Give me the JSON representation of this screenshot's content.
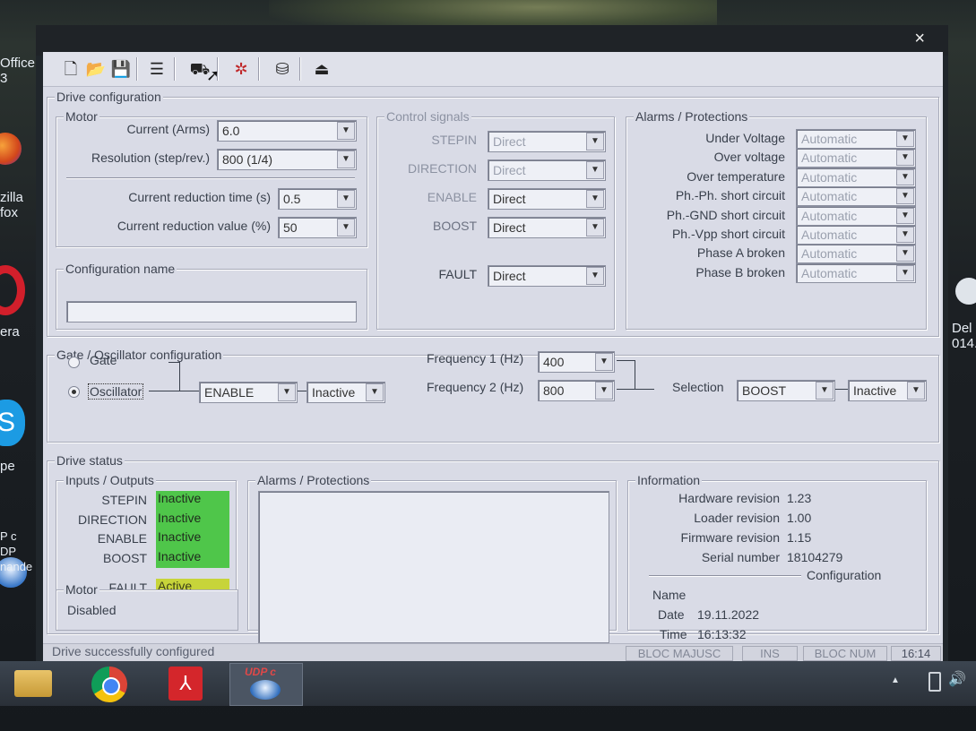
{
  "desktop": {
    "icons": [
      {
        "label": "Office\n3"
      },
      {
        "label": "zilla\nfox"
      },
      {
        "label": "era"
      },
      {
        "label": "pe"
      },
      {
        "label": "P c\nDP\nnande"
      },
      {
        "label": "Del\n014."
      }
    ]
  },
  "window": {
    "close_glyph": "×"
  },
  "toolbar": {
    "icons": [
      "new-file-icon",
      "open-folder-icon",
      "save-icon",
      "settings-list-icon",
      "write-drive-icon",
      "motor-config-icon",
      "storage-icon",
      "exit-icon"
    ],
    "glyphs": [
      "🗋",
      "📂",
      "💾",
      "☰",
      "⛟",
      "✲",
      "⛁",
      "⏏"
    ]
  },
  "drive_config": {
    "legend": "Drive configuration",
    "motor": {
      "legend": "Motor",
      "current_label": "Current (Arms)",
      "current_value": "6.0",
      "resolution_label": "Resolution (step/rev.)",
      "resolution_value": "800 (1/4)",
      "reduction_time_label": "Current reduction time (s)",
      "reduction_time_value": "0.5",
      "reduction_value_label": "Current reduction value (%)",
      "reduction_value_value": "50"
    },
    "config_name": {
      "legend": "Configuration name",
      "value": ""
    },
    "control_signals": {
      "legend": "Control signals",
      "rows": [
        {
          "label": "STEPIN",
          "value": "Direct"
        },
        {
          "label": "DIRECTION",
          "value": "Direct"
        },
        {
          "label": "ENABLE",
          "value": "Direct"
        },
        {
          "label": "BOOST",
          "value": "Direct"
        }
      ],
      "fault_label": "FAULT",
      "fault_value": "Direct"
    },
    "alarms": {
      "legend": "Alarms / Protections",
      "rows": [
        {
          "label": "Under Voltage",
          "value": "Automatic"
        },
        {
          "label": "Over voltage",
          "value": "Automatic"
        },
        {
          "label": "Over temperature",
          "value": "Automatic"
        },
        {
          "label": "Ph.-Ph. short circuit",
          "value": "Automatic"
        },
        {
          "label": "Ph.-GND short circuit",
          "value": "Automatic"
        },
        {
          "label": "Ph.-Vpp short circuit",
          "value": "Automatic"
        },
        {
          "label": "Phase A broken",
          "value": "Automatic"
        },
        {
          "label": "Phase B broken",
          "value": "Automatic"
        }
      ]
    }
  },
  "gate_osc": {
    "legend": "Gate / Oscillator configuration",
    "gate_label": "Gate",
    "oscillator_label": "Oscillator",
    "selected": "Oscillator",
    "signal_value": "ENABLE",
    "signal_state": "Inactive",
    "freq1_label": "Frequency 1 (Hz)",
    "freq1_value": "400",
    "freq2_label": "Frequency 2 (Hz)",
    "freq2_value": "800",
    "selection_label": "Selection",
    "selection_value": "BOOST",
    "selection_state": "Inactive"
  },
  "drive_status": {
    "legend": "Drive status",
    "io": {
      "legend": "Inputs / Outputs",
      "rows": [
        {
          "label": "STEPIN",
          "value": "Inactive"
        },
        {
          "label": "DIRECTION",
          "value": "Inactive"
        },
        {
          "label": "ENABLE",
          "value": "Inactive"
        },
        {
          "label": "BOOST",
          "value": "Inactive"
        }
      ],
      "fault_label": "FAULT",
      "fault_value": "Active",
      "colors": {
        "inactive": "#4fc64a",
        "active": "#c7d43a"
      }
    },
    "motor": {
      "legend": "Motor",
      "value": "Disabled"
    },
    "alarms": {
      "legend": "Alarms / Protections"
    },
    "info": {
      "legend": "Information",
      "hw_label": "Hardware revision",
      "hw_value": "1.23",
      "loader_label": "Loader revision",
      "loader_value": "1.00",
      "fw_label": "Firmware revision",
      "fw_value": "1.15",
      "serial_label": "Serial number",
      "serial_value": "18104279",
      "config_label": "Configuration",
      "name_label": "Name",
      "name_value": "",
      "date_label": "Date",
      "date_value": "19.11.2022",
      "time_label": "Time",
      "time_value": "16:13:32"
    }
  },
  "statusbar": {
    "message": "Drive successfully configured",
    "caps": "BLOC MAJUSC",
    "ins": "INS",
    "num": "BLOC NUM",
    "clock": "16:14"
  },
  "taskbar": {
    "apps": [
      {
        "name": "file-explorer"
      },
      {
        "name": "chrome"
      },
      {
        "name": "acrobat"
      },
      {
        "name": "udp-config",
        "label": "UDP c"
      }
    ]
  }
}
